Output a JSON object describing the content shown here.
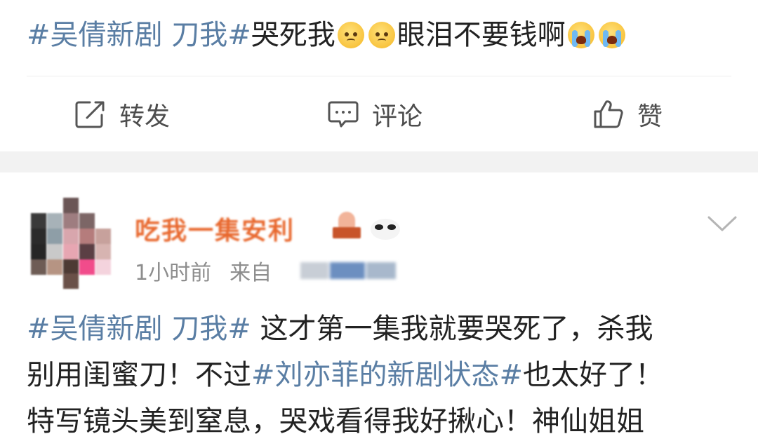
{
  "top_post": {
    "tag1": "#吴倩新剧 刀我#",
    "text1": "哭死我",
    "text2": "眼泪不要钱啊",
    "emoji1": "sad-face-icon",
    "emoji2": "crying-face-icon"
  },
  "actions": {
    "repost_label": "转发",
    "comment_label": "评论",
    "like_label": "赞"
  },
  "second_post": {
    "username": "吃我一集安利",
    "time": "1小时前",
    "source_prefix": "来自",
    "line1_tag": "#吴倩新剧 刀我#",
    "line1_text": " 这才第一集我就要哭死了，杀我",
    "line2_text_a": "别用闺蜜刀！不过",
    "line2_tag": "#刘亦菲的新剧状态#",
    "line2_text_b": "也太好了！",
    "line3_text": "特写镜头美到窒息，哭戏看得我好揪心！神仙姐姐"
  },
  "colors": {
    "tag_link": "#5a7ea4",
    "username": "#e8682e",
    "meta_gray": "#8d8d8d",
    "separator": "#f2f2f2"
  }
}
